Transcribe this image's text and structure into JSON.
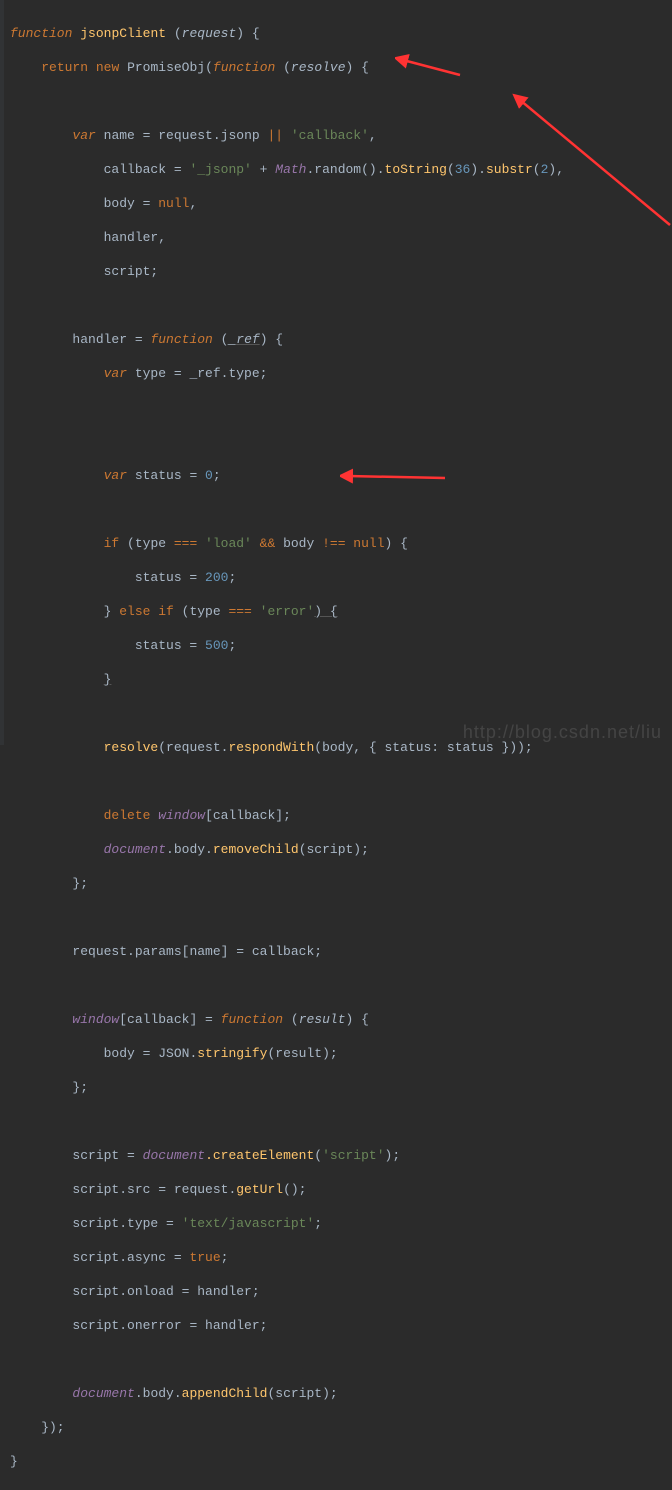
{
  "watermark": "http://blog.csdn.net/liu",
  "code": {
    "l1_function": "function",
    "l1_name": "jsonpClient",
    "l1_param": "request",
    "l2_return": "return",
    "l2_new": "new",
    "l2_promise": "PromiseObj",
    "l2_function": "function",
    "l2_resolve": "resolve",
    "l3_var": "var",
    "l3_name": "name = request.jsonp ",
    "l3_or": "||",
    "l3_str": " 'callback'",
    "l4_callback": "callback = ",
    "l4_str": "'_jsonp'",
    "l4_plus": " + ",
    "l4_math": "Math",
    "l4_random": ".random().",
    "l4_tostring": "toString",
    "l4_36": "36",
    "l4_substr": "substr",
    "l4_2": "2",
    "l5_body": "body = ",
    "l5_null": "null",
    "l6_handler": "handler,",
    "l7_script": "script;",
    "l8_handler": "handler = ",
    "l8_function": "function",
    "l8_ref": "_ref",
    "l9_var": "var",
    "l9_type": " type = _ref.type;",
    "l10_var": "var",
    "l10_status": " status = ",
    "l10_zero": "0",
    "l11_if": "if",
    "l11_type": " (type ",
    "l11_eq": "===",
    "l11_load": " 'load' ",
    "l11_and": "&&",
    "l11_body": " body ",
    "l11_neq": "!==",
    "l11_null": " null",
    "l12_status": "status = ",
    "l12_200": "200",
    "l13_else": "} ",
    "l13_elsekw": "else if",
    "l13_cond": " (type ",
    "l13_eq": "===",
    "l13_error": " 'error'",
    "l13_brace": ") {",
    "l14_status": "status = ",
    "l14_500": "500",
    "l15_brace": "}",
    "l16_resolve": "resolve",
    "l16_req": "(request.",
    "l16_respond": "respondWith",
    "l16_args": "(body, { status: status }));",
    "l17_delete": "delete",
    "l17_window": "window",
    "l17_cb": "[callback];",
    "l18_doc": "document",
    "l18_body": ".body.",
    "l18_remove": "removeChild",
    "l18_script": "(script);",
    "l19_params": "request.params[name] = callback;",
    "l20_window": "window",
    "l20_cb": "[callback] = ",
    "l20_function": "function",
    "l20_result": "result",
    "l21_body": "body = JSON.",
    "l21_stringify": "stringify",
    "l21_res": "(result);",
    "l22_script": "script = ",
    "l22_doc": "document",
    "l22_create": ".createElement",
    "l22_str": "'script'",
    "l23_src": "script.src = request.",
    "l23_geturl": "getUrl",
    "l24_type": "script.type = ",
    "l24_str": "'text/javascript'",
    "l25_async": "script.async = ",
    "l25_true": "true",
    "l26_onload": "script.onload = handler;",
    "l27_onerror": "script.onerror = handler;",
    "l28_doc": "document",
    "l28_body": ".body.",
    "l28_append": "appendChild",
    "l28_script": "(script);"
  }
}
